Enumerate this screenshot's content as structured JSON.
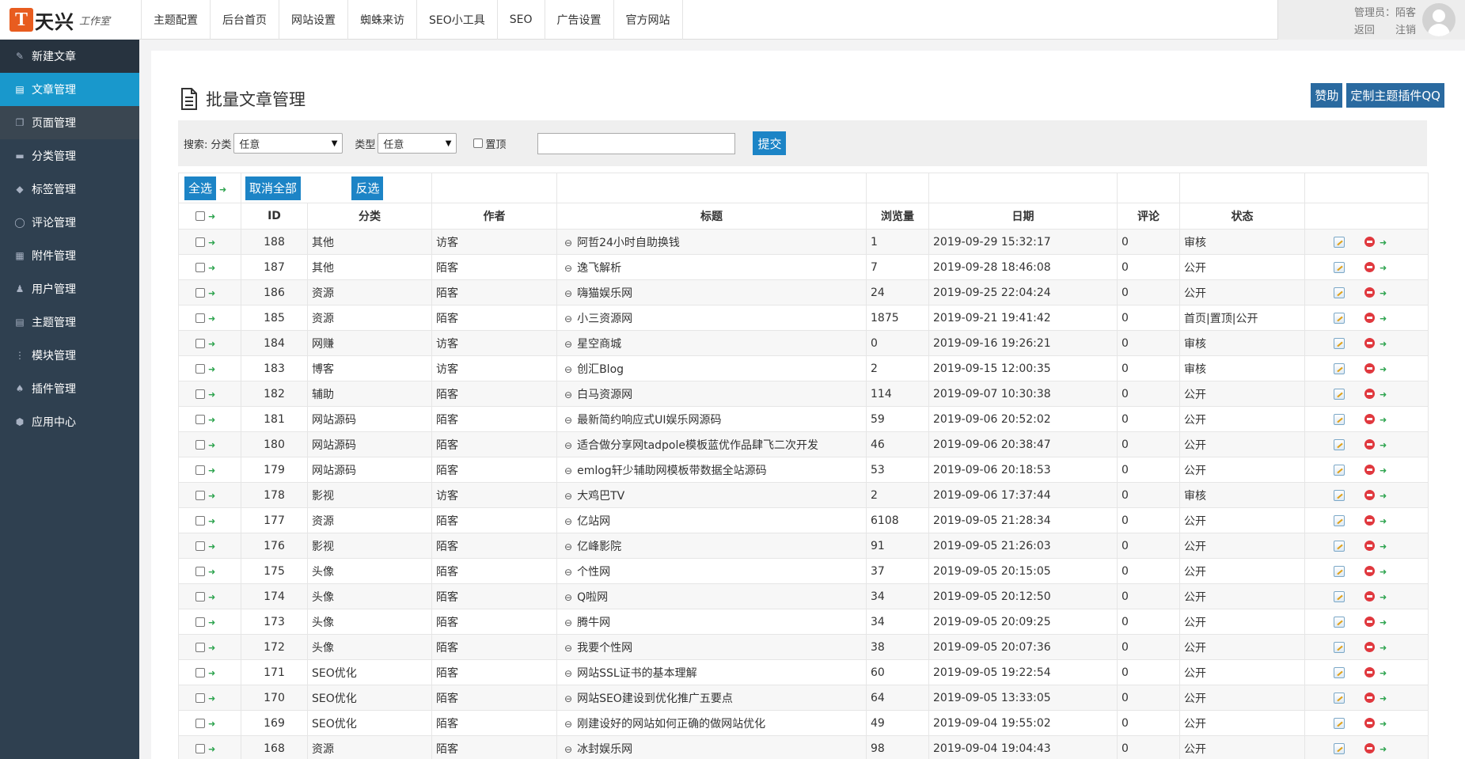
{
  "logo": {
    "mark": "T",
    "name": "天兴",
    "sub": "工作室"
  },
  "topnav": [
    "主题配置",
    "后台首页",
    "网站设置",
    "蜘蛛来访",
    "SEO小工具",
    "SEO",
    "广告设置",
    "官方网站"
  ],
  "user": {
    "label": "管理员：陌客",
    "back": "返回",
    "logout": "注销"
  },
  "sidebar": [
    {
      "label": "新建文章",
      "icon": "edit-icon"
    },
    {
      "label": "文章管理",
      "icon": "file-icon"
    },
    {
      "label": "页面管理",
      "icon": "copy-icon"
    },
    {
      "label": "分类管理",
      "icon": "folder-icon"
    },
    {
      "label": "标签管理",
      "icon": "tag-icon"
    },
    {
      "label": "评论管理",
      "icon": "comment-icon"
    },
    {
      "label": "附件管理",
      "icon": "archive-icon"
    },
    {
      "label": "用户管理",
      "icon": "user-icon"
    },
    {
      "label": "主题管理",
      "icon": "theme-icon"
    },
    {
      "label": "模块管理",
      "icon": "module-icon"
    },
    {
      "label": "插件管理",
      "icon": "plugin-icon"
    },
    {
      "label": "应用中心",
      "icon": "cube-icon"
    }
  ],
  "page": {
    "title": "批量文章管理",
    "sponsor": "赞助",
    "custom": "定制主题插件QQ"
  },
  "search": {
    "label": "搜索:",
    "category_label": "分类",
    "category_value": "任意",
    "type_label": "类型",
    "type_value": "任意",
    "top_label": "置顶",
    "submit": "提交"
  },
  "tools": {
    "select_all": "全选",
    "deselect_all": "取消全部",
    "invert": "反选"
  },
  "columns": [
    "ID",
    "分类",
    "作者",
    "标题",
    "浏览量",
    "日期",
    "评论",
    "状态"
  ],
  "rows": [
    {
      "id": "188",
      "cat": "其他",
      "author": "访客",
      "title": "阿哲24小时自助换钱",
      "views": "1",
      "date": "2019-09-29 15:32:17",
      "comments": "0",
      "status": "审核"
    },
    {
      "id": "187",
      "cat": "其他",
      "author": "陌客",
      "title": "逸飞解析",
      "views": "7",
      "date": "2019-09-28 18:46:08",
      "comments": "0",
      "status": "公开"
    },
    {
      "id": "186",
      "cat": "资源",
      "author": "陌客",
      "title": "嗨猫娱乐网",
      "views": "24",
      "date": "2019-09-25 22:04:24",
      "comments": "0",
      "status": "公开"
    },
    {
      "id": "185",
      "cat": "资源",
      "author": "陌客",
      "title": "小三资源网",
      "views": "1875",
      "date": "2019-09-21 19:41:42",
      "comments": "0",
      "status": "首页|置顶|公开"
    },
    {
      "id": "184",
      "cat": "网赚",
      "author": "访客",
      "title": "星空商城",
      "views": "0",
      "date": "2019-09-16 19:26:21",
      "comments": "0",
      "status": "审核"
    },
    {
      "id": "183",
      "cat": "博客",
      "author": "访客",
      "title": "创汇Blog",
      "views": "2",
      "date": "2019-09-15 12:00:35",
      "comments": "0",
      "status": "审核"
    },
    {
      "id": "182",
      "cat": "辅助",
      "author": "陌客",
      "title": "白马资源网",
      "views": "114",
      "date": "2019-09-07 10:30:38",
      "comments": "0",
      "status": "公开"
    },
    {
      "id": "181",
      "cat": "网站源码",
      "author": "陌客",
      "title": "最新简约响应式UI娱乐网源码",
      "views": "59",
      "date": "2019-09-06 20:52:02",
      "comments": "0",
      "status": "公开"
    },
    {
      "id": "180",
      "cat": "网站源码",
      "author": "陌客",
      "title": "适合做分享网tadpole模板蓝优作品肆飞二次开发",
      "views": "46",
      "date": "2019-09-06 20:38:47",
      "comments": "0",
      "status": "公开"
    },
    {
      "id": "179",
      "cat": "网站源码",
      "author": "陌客",
      "title": "emlog轩少辅助网模板带数据全站源码",
      "views": "53",
      "date": "2019-09-06 20:18:53",
      "comments": "0",
      "status": "公开"
    },
    {
      "id": "178",
      "cat": "影视",
      "author": "访客",
      "title": "大鸡巴TV",
      "views": "2",
      "date": "2019-09-06 17:37:44",
      "comments": "0",
      "status": "审核"
    },
    {
      "id": "177",
      "cat": "资源",
      "author": "陌客",
      "title": "亿站网",
      "views": "6108",
      "date": "2019-09-05 21:28:34",
      "comments": "0",
      "status": "公开"
    },
    {
      "id": "176",
      "cat": "影视",
      "author": "陌客",
      "title": "亿峰影院",
      "views": "91",
      "date": "2019-09-05 21:26:03",
      "comments": "0",
      "status": "公开"
    },
    {
      "id": "175",
      "cat": "头像",
      "author": "陌客",
      "title": "个性网",
      "views": "37",
      "date": "2019-09-05 20:15:05",
      "comments": "0",
      "status": "公开"
    },
    {
      "id": "174",
      "cat": "头像",
      "author": "陌客",
      "title": "Q啦网",
      "views": "34",
      "date": "2019-09-05 20:12:50",
      "comments": "0",
      "status": "公开"
    },
    {
      "id": "173",
      "cat": "头像",
      "author": "陌客",
      "title": "腾牛网",
      "views": "34",
      "date": "2019-09-05 20:09:25",
      "comments": "0",
      "status": "公开"
    },
    {
      "id": "172",
      "cat": "头像",
      "author": "陌客",
      "title": "我要个性网",
      "views": "38",
      "date": "2019-09-05 20:07:36",
      "comments": "0",
      "status": "公开"
    },
    {
      "id": "171",
      "cat": "SEO优化",
      "author": "陌客",
      "title": "网站SSL证书的基本理解",
      "views": "60",
      "date": "2019-09-05 19:22:54",
      "comments": "0",
      "status": "公开"
    },
    {
      "id": "170",
      "cat": "SEO优化",
      "author": "陌客",
      "title": "网站SEO建设到优化推广五要点",
      "views": "64",
      "date": "2019-09-05 13:33:05",
      "comments": "0",
      "status": "公开"
    },
    {
      "id": "169",
      "cat": "SEO优化",
      "author": "陌客",
      "title": "刚建设好的网站如何正确的做网站优化",
      "views": "49",
      "date": "2019-09-04 19:55:02",
      "comments": "0",
      "status": "公开"
    },
    {
      "id": "168",
      "cat": "资源",
      "author": "陌客",
      "title": "冰封娱乐网",
      "views": "98",
      "date": "2019-09-04 19:04:43",
      "comments": "0",
      "status": "公开"
    }
  ],
  "colors": {
    "sidebar_bg": "#2f4050",
    "active": "#1998cc",
    "button": "#1c84c6"
  }
}
